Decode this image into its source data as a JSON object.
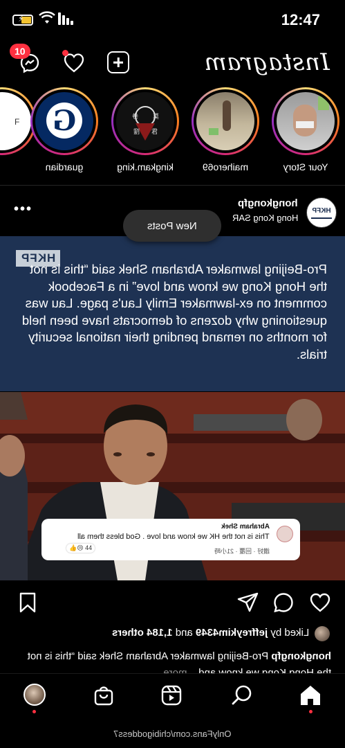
{
  "status_bar": {
    "time": "12:47",
    "battery_color": "#f2c230"
  },
  "top_bar": {
    "logo": "Instagram",
    "notification_count": "10",
    "icons": [
      "messenger-icon",
      "heart-icon",
      "add-post-icon"
    ]
  },
  "stories": [
    {
      "username": "Your Story"
    },
    {
      "username": "maihero69"
    },
    {
      "username": "kingkam.king"
    },
    {
      "username": "guardian"
    },
    {
      "username": "r"
    }
  ],
  "post": {
    "username": "hongkongfp",
    "location": "Hong Kong SAR",
    "avatar_label": "HKFP",
    "new_posts_label": "New Posts",
    "card": {
      "tag": "HKFP",
      "text": "Pro-Beijing lawmaker Abraham Shek said “this is not the Hong Kong we know and love” in a Facebook comment on ex-lawmaker Emily Lau's page. Lau was questioning why dozens of democrats have been held for months on remand pending their national security trials."
    },
    "fb_comment": {
      "name": "Abraham Shek",
      "text": "This is not the HK we know and love . God bless them all",
      "meta": "讚好 · 回覆 · 21小時",
      "reactions": "44"
    },
    "likes": {
      "liked_by_prefix": "Liked by",
      "liked_by_user": "jeffreykim4349",
      "liked_by_suffix": "and",
      "others": "1,184 others"
    },
    "caption": {
      "username": "hongkongfp",
      "text": "Pro-Beijing lawmaker Abraham Shek said “this is not the Hong Kong we know and...",
      "more": "more"
    }
  },
  "colors": {
    "card_bg": "#1e3253",
    "badge": "#ff3040"
  },
  "footer": {
    "url": "OnlyFans.com/chibigoddess7"
  }
}
